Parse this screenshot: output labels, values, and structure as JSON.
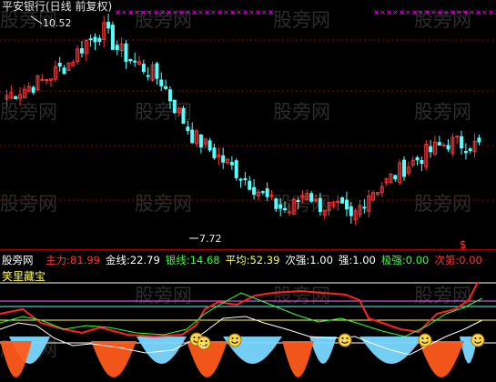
{
  "window": {
    "title": "平安银行(日线 前复权)",
    "watermark": "股旁网"
  },
  "price_labels": {
    "high": "10.52",
    "low": "7.72"
  },
  "indicator": {
    "source": "股旁网",
    "name": "笑里藏宝",
    "values": [
      {
        "label": "主力:",
        "value": "81.99",
        "color": "#ff3333"
      },
      {
        "label": "金线:",
        "value": "22.79",
        "color": "#ffffff"
      },
      {
        "label": "银线:",
        "value": "14.68",
        "color": "#33ff33"
      },
      {
        "label": "平均:",
        "value": "52.39",
        "color": "#ffff55"
      },
      {
        "label": "次强:",
        "value": "1.00",
        "color": "#ffffff"
      },
      {
        "label": "强:",
        "value": "1.00",
        "color": "#ffffff"
      },
      {
        "label": "极强:",
        "value": "0.00",
        "color": "#33ff33"
      },
      {
        "label": "次第:",
        "value": "0.00",
        "color": "#ff3333"
      }
    ]
  },
  "colors": {
    "up": "#ff3333",
    "down": "#54ffff",
    "grid": "#a00000",
    "marker_row": "#ff00ff",
    "smile": "#ffd84a",
    "orange_bar": "#ff5a1a",
    "cyan_bar": "#7ad8ff"
  },
  "chart_data": {
    "type": "candlestick",
    "visible_extremes": {
      "high": 10.52,
      "low": 7.72
    }
  }
}
